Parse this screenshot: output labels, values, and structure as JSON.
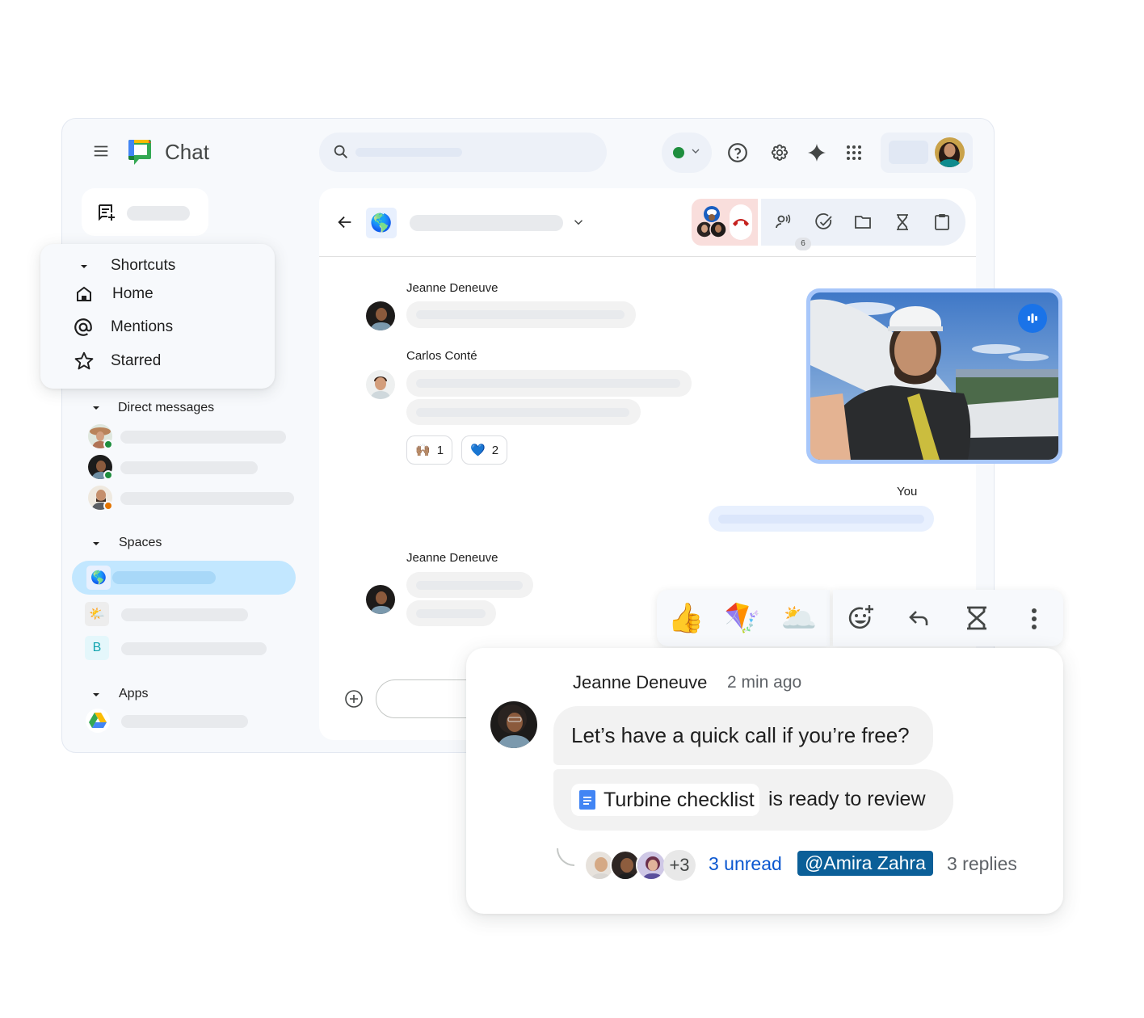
{
  "app": {
    "title": "Chat",
    "colors": {
      "accent": "#0b57d0",
      "active_space": "#c2e7ff",
      "online": "#1e8e3e",
      "away": "#e37400",
      "mention_bg": "#0b5f98",
      "hangup": "#c5221f"
    }
  },
  "header": {
    "menu_icon": "hamburger-icon",
    "search_icon": "search-icon",
    "status": "online",
    "icons": [
      "help-icon",
      "settings-icon",
      "gemini-sparkle-icon",
      "apps-grid-icon"
    ]
  },
  "sidebar": {
    "new_chat_icon": "new-chat-icon",
    "shortcuts": {
      "label": "Shortcuts",
      "items": [
        {
          "label": "Home",
          "icon": "home-icon"
        },
        {
          "label": "Mentions",
          "icon": "at-sign-icon"
        },
        {
          "label": "Starred",
          "icon": "star-icon"
        }
      ]
    },
    "direct_messages": {
      "label": "Direct messages",
      "items": [
        {
          "presence": "online"
        },
        {
          "presence": "online"
        },
        {
          "presence": "away"
        }
      ]
    },
    "spaces": {
      "label": "Spaces",
      "items": [
        {
          "icon": "🌎",
          "active": true
        },
        {
          "icon": "🌤️",
          "active": false
        },
        {
          "icon": "B",
          "active": false
        }
      ]
    },
    "apps": {
      "label": "Apps",
      "items": [
        {
          "icon": "google-drive-icon"
        }
      ]
    }
  },
  "conversation": {
    "space_emoji": "🌎",
    "member_count": "6",
    "toolbar_icons": [
      "members-icon",
      "tasks-icon",
      "files-icon",
      "hourglass-icon",
      "clipboard-icon"
    ],
    "messages": [
      {
        "sender": "Jeanne Deneuve"
      },
      {
        "sender": "Carlos Conté",
        "reactions": [
          {
            "emoji": "🙌🏽",
            "count": "1"
          },
          {
            "emoji": "💙",
            "count": "2"
          }
        ]
      },
      {
        "sender": "You"
      },
      {
        "sender": "Jeanne Deneuve"
      }
    ]
  },
  "hover_toolbar": {
    "quick_reactions": [
      "👍",
      "🪁",
      "🌥️"
    ],
    "actions": [
      "add-reaction-icon",
      "reply-icon",
      "hourglass-icon",
      "more-vert-icon"
    ]
  },
  "message_card": {
    "sender": "Jeanne Deneuve",
    "time": "2 min ago",
    "text": "Let’s have a quick call if you’re free?",
    "doc_chip": "Turbine checklist",
    "doc_suffix": "is ready to review",
    "thread": {
      "more_count": "+3",
      "unread": "3 unread",
      "mention": "@Amira Zahra",
      "replies": "3 replies"
    }
  }
}
